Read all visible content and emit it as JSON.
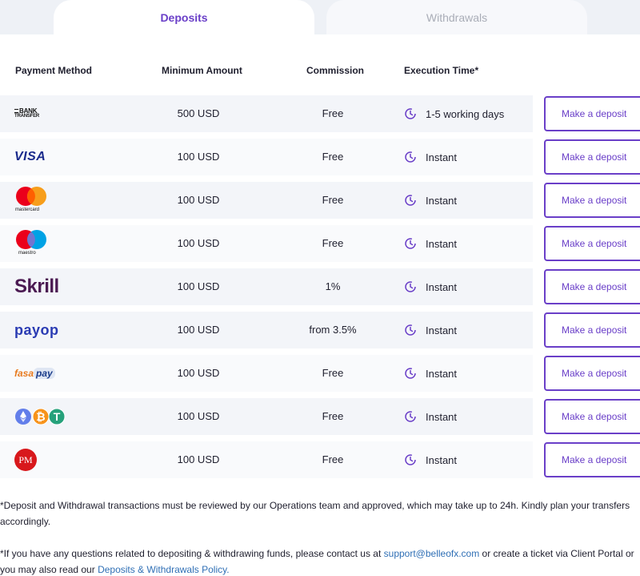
{
  "tabs": {
    "deposits": "Deposits",
    "withdrawals": "Withdrawals"
  },
  "table": {
    "headers": {
      "method": "Payment Method",
      "minimum": "Minimum Amount",
      "commission": "Commission",
      "execution": "Execution Time*"
    },
    "button_label": "Make a deposit",
    "rows": [
      {
        "method": "Bank Transfer",
        "logo_text_1": "BANK",
        "logo_text_2": "TRANSFER",
        "minimum": "500 USD",
        "commission": "Free",
        "execution": "1-5 working days"
      },
      {
        "method": "Visa",
        "logo_text": "VISA",
        "minimum": "100 USD",
        "commission": "Free",
        "execution": "Instant"
      },
      {
        "method": "Mastercard",
        "logo_text": "mastercard",
        "minimum": "100 USD",
        "commission": "Free",
        "execution": "Instant"
      },
      {
        "method": "Maestro",
        "logo_text": "maestro",
        "minimum": "100 USD",
        "commission": "Free",
        "execution": "Instant"
      },
      {
        "method": "Skrill",
        "logo_text": "Skrill",
        "minimum": "100 USD",
        "commission": "1%",
        "execution": "Instant"
      },
      {
        "method": "Payop",
        "logo_text": "payop",
        "minimum": "100 USD",
        "commission": "from 3.5%",
        "execution": "Instant"
      },
      {
        "method": "FasaPay",
        "logo_text_1": "fasa",
        "logo_text_2": "pay",
        "minimum": "100 USD",
        "commission": "Free",
        "execution": "Instant"
      },
      {
        "method": "Crypto",
        "minimum": "100 USD",
        "commission": "Free",
        "execution": "Instant"
      },
      {
        "method": "Perfect Money",
        "logo_text": "PM",
        "minimum": "100 USD",
        "commission": "Free",
        "execution": "Instant"
      }
    ]
  },
  "notes": {
    "note1": "*Deposit and Withdrawal transactions must be reviewed by our Operations team and approved, which may take up to 24h. Kindly plan your transfers accordingly.",
    "note2_prefix": "*If you have any questions related to depositing & withdrawing funds, please contact us at ",
    "note2_email": "support@belleofx.com",
    "note2_middle": " or create a ticket via Client Portal or you may also read our ",
    "note2_link": "Deposits & Withdrawals Policy."
  },
  "colors": {
    "accent": "#6a3fc8",
    "link": "#2f6fb5",
    "row_alt": "#f3f5f9"
  },
  "icons": {
    "execution": "clock-icon"
  }
}
